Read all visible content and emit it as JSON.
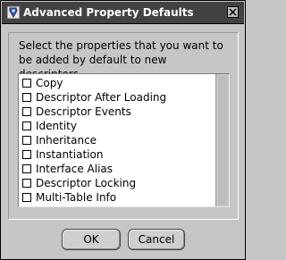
{
  "window": {
    "title": "Advanced Property Defaults"
  },
  "instructions": "Select the properties that you want to be added by default to new descriptors.",
  "properties": [
    {
      "label": "Copy",
      "checked": false
    },
    {
      "label": "Descriptor After Loading",
      "checked": false
    },
    {
      "label": "Descriptor Events",
      "checked": false
    },
    {
      "label": "Identity",
      "checked": false
    },
    {
      "label": "Inheritance",
      "checked": false
    },
    {
      "label": "Instantiation",
      "checked": false
    },
    {
      "label": "Interface Alias",
      "checked": false
    },
    {
      "label": "Descriptor Locking",
      "checked": false
    },
    {
      "label": "Multi-Table Info",
      "checked": false
    }
  ],
  "buttons": {
    "ok": "OK",
    "cancel": "Cancel"
  },
  "icons": {
    "app": "app-icon",
    "close": "close-icon"
  }
}
